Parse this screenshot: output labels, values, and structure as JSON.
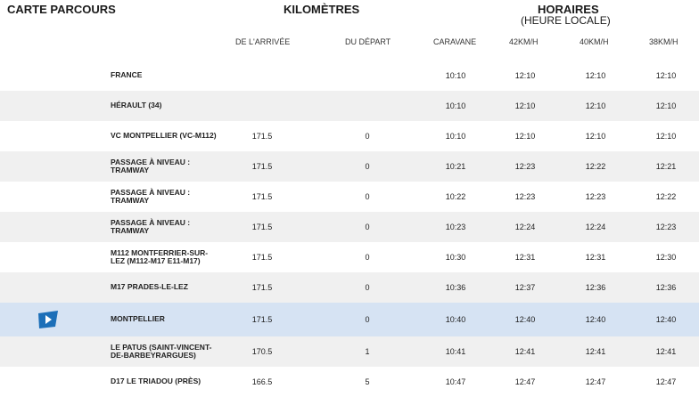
{
  "header": {
    "carte_parcours": "CARTE PARCOURS",
    "kilometres": "KILOMÈTRES",
    "horaires": "HORAIRES",
    "horaires_sub": "(HEURE LOCALE)"
  },
  "columns": {
    "arrivee": "DE L'ARRIVÉE",
    "depart": "DU DÉPART",
    "caravane": "CARAVANE",
    "s42": "42KM/H",
    "s40": "40KM/H",
    "s38": "38KM/H"
  },
  "colors": {
    "alt_row": "#f0f0f0",
    "highlight_row": "#d6e3f3",
    "flag_icon": "#1c6fb8"
  },
  "rows": [
    {
      "location": "FRANCE",
      "arrivee": "",
      "depart": "",
      "caravane": "10:10",
      "s42": "12:10",
      "s40": "12:10",
      "s38": "12:10"
    },
    {
      "location": "HÉRAULT (34)",
      "arrivee": "",
      "depart": "",
      "caravane": "10:10",
      "s42": "12:10",
      "s40": "12:10",
      "s38": "12:10"
    },
    {
      "location": "VC MONTPELLIER (VC-M112)",
      "arrivee": "171.5",
      "depart": "0",
      "caravane": "10:10",
      "s42": "12:10",
      "s40": "12:10",
      "s38": "12:10"
    },
    {
      "location": "PASSAGE À NIVEAU : TRAMWAY",
      "arrivee": "171.5",
      "depart": "0",
      "caravane": "10:21",
      "s42": "12:23",
      "s40": "12:22",
      "s38": "12:21"
    },
    {
      "location": "PASSAGE À NIVEAU : TRAMWAY",
      "arrivee": "171.5",
      "depart": "0",
      "caravane": "10:22",
      "s42": "12:23",
      "s40": "12:23",
      "s38": "12:22"
    },
    {
      "location": "PASSAGE À NIVEAU : TRAMWAY",
      "arrivee": "171.5",
      "depart": "0",
      "caravane": "10:23",
      "s42": "12:24",
      "s40": "12:24",
      "s38": "12:23"
    },
    {
      "location": "M112 MONTFERRIER-SUR-LEZ (M112-M17 E11-M17)",
      "arrivee": "171.5",
      "depart": "0",
      "caravane": "10:30",
      "s42": "12:31",
      "s40": "12:31",
      "s38": "12:30"
    },
    {
      "location": "M17 PRADES-LE-LEZ",
      "arrivee": "171.5",
      "depart": "0",
      "caravane": "10:36",
      "s42": "12:37",
      "s40": "12:36",
      "s38": "12:36"
    },
    {
      "location": "MONTPELLIER",
      "arrivee": "171.5",
      "depart": "0",
      "caravane": "10:40",
      "s42": "12:40",
      "s40": "12:40",
      "s38": "12:40",
      "icon": "departure-flag-icon"
    },
    {
      "location": "LE PATUS (SAINT-VINCENT-DE-BARBEYRARGUES)",
      "arrivee": "170.5",
      "depart": "1",
      "caravane": "10:41",
      "s42": "12:41",
      "s40": "12:41",
      "s38": "12:41"
    },
    {
      "location": "D17 LE TRIADOU (PRÈS)",
      "arrivee": "166.5",
      "depart": "5",
      "caravane": "10:47",
      "s42": "12:47",
      "s40": "12:47",
      "s38": "12:47"
    }
  ]
}
